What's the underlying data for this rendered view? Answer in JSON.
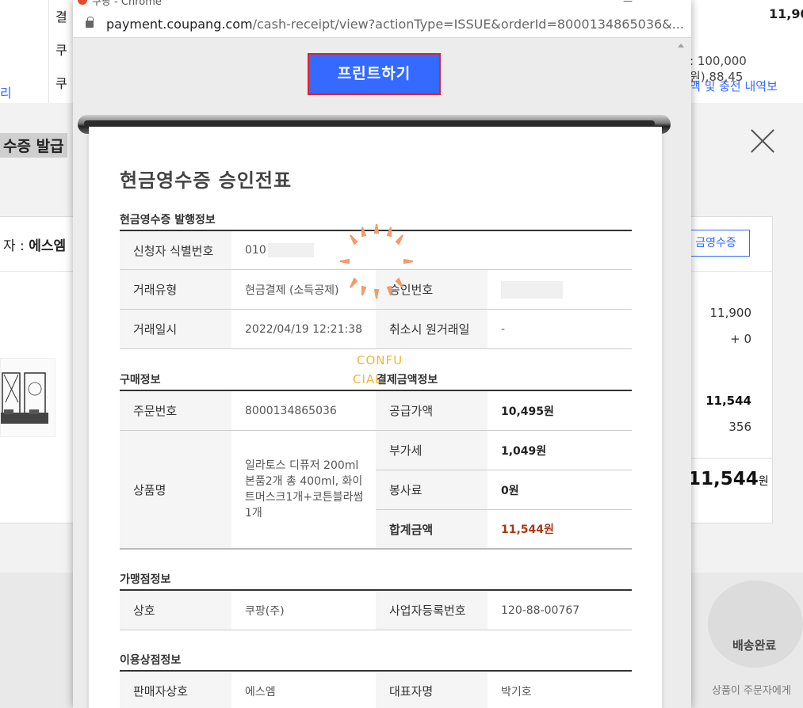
{
  "background": {
    "left_rows": [
      "결",
      "쿠",
      "쿠"
    ],
    "top_right_total": "11,90",
    "top_right_note": ": 100,000 원),88,45",
    "top_right_link": "액 및 충전 내역보",
    "left_link_char": "리",
    "modal_title_fragment": "수증 발급",
    "seller_prefix": "자 : ",
    "seller_name": "에스엠",
    "cash_receipt_button": "금영수증",
    "amounts": [
      "11,900",
      "+ 0",
      "11,544",
      "356"
    ],
    "total_amount": "11,544",
    "total_unit": "원",
    "delivery_status": "배송완료",
    "delivery_note": "상품이 주문자에게"
  },
  "popup": {
    "title": "쿠팡 - Chrome",
    "url_host": "payment.coupang.com",
    "url_path": "/cash-receipt/view?actionType=ISSUE&orderId=8000134865036&...",
    "print_button": "프린트하기",
    "receipt": {
      "title": "현금영수증 승인전표",
      "issue_section": "현금영수증 발행정보",
      "applicant_id_label": "신청자 식별번호",
      "applicant_id_value": "010",
      "trade_type_label": "거래유형",
      "trade_type_value": "현금결제 (소득공제)",
      "approval_no_label": "승인번호",
      "trade_datetime_label": "거래일시",
      "trade_datetime_value": "2022/04/19 12:21:38",
      "cancel_orig_date_label": "취소시 원거래일",
      "cancel_orig_date_value": "-",
      "purchase_section": "구매정보",
      "payment_section": "결제금액정보",
      "order_no_label": "주문번호",
      "order_no_value": "8000134865036",
      "supply_price_label": "공급가액",
      "supply_price_value": "10,495원",
      "product_label": "상품명",
      "product_value": "일라토스 디퓨저 200ml 본품2개 총 400ml, 화이트머스크1개+코튼블라썸1개",
      "vat_label": "부가세",
      "vat_value": "1,049원",
      "service_fee_label": "봉사료",
      "service_fee_value": "0원",
      "total_label": "합계금액",
      "total_value": "11,544원",
      "merchant_section": "가맹점정보",
      "merchant_name_label": "상호",
      "merchant_name_value": "쿠팡(주)",
      "business_no_label": "사업자등록번호",
      "business_no_value": "120-88-00767",
      "seller_section": "이용상점정보",
      "seller_name_label": "판매자상호",
      "seller_name_value": "에스엠",
      "ceo_label": "대표자명",
      "ceo_value": "박기호",
      "stamp_line1": "CONFU",
      "stamp_line2": "CIAL"
    }
  },
  "colors": {
    "accent": "#346aff",
    "button_border": "#e0202f",
    "total_red": "#a6391a",
    "stamp": "#f3b632"
  }
}
